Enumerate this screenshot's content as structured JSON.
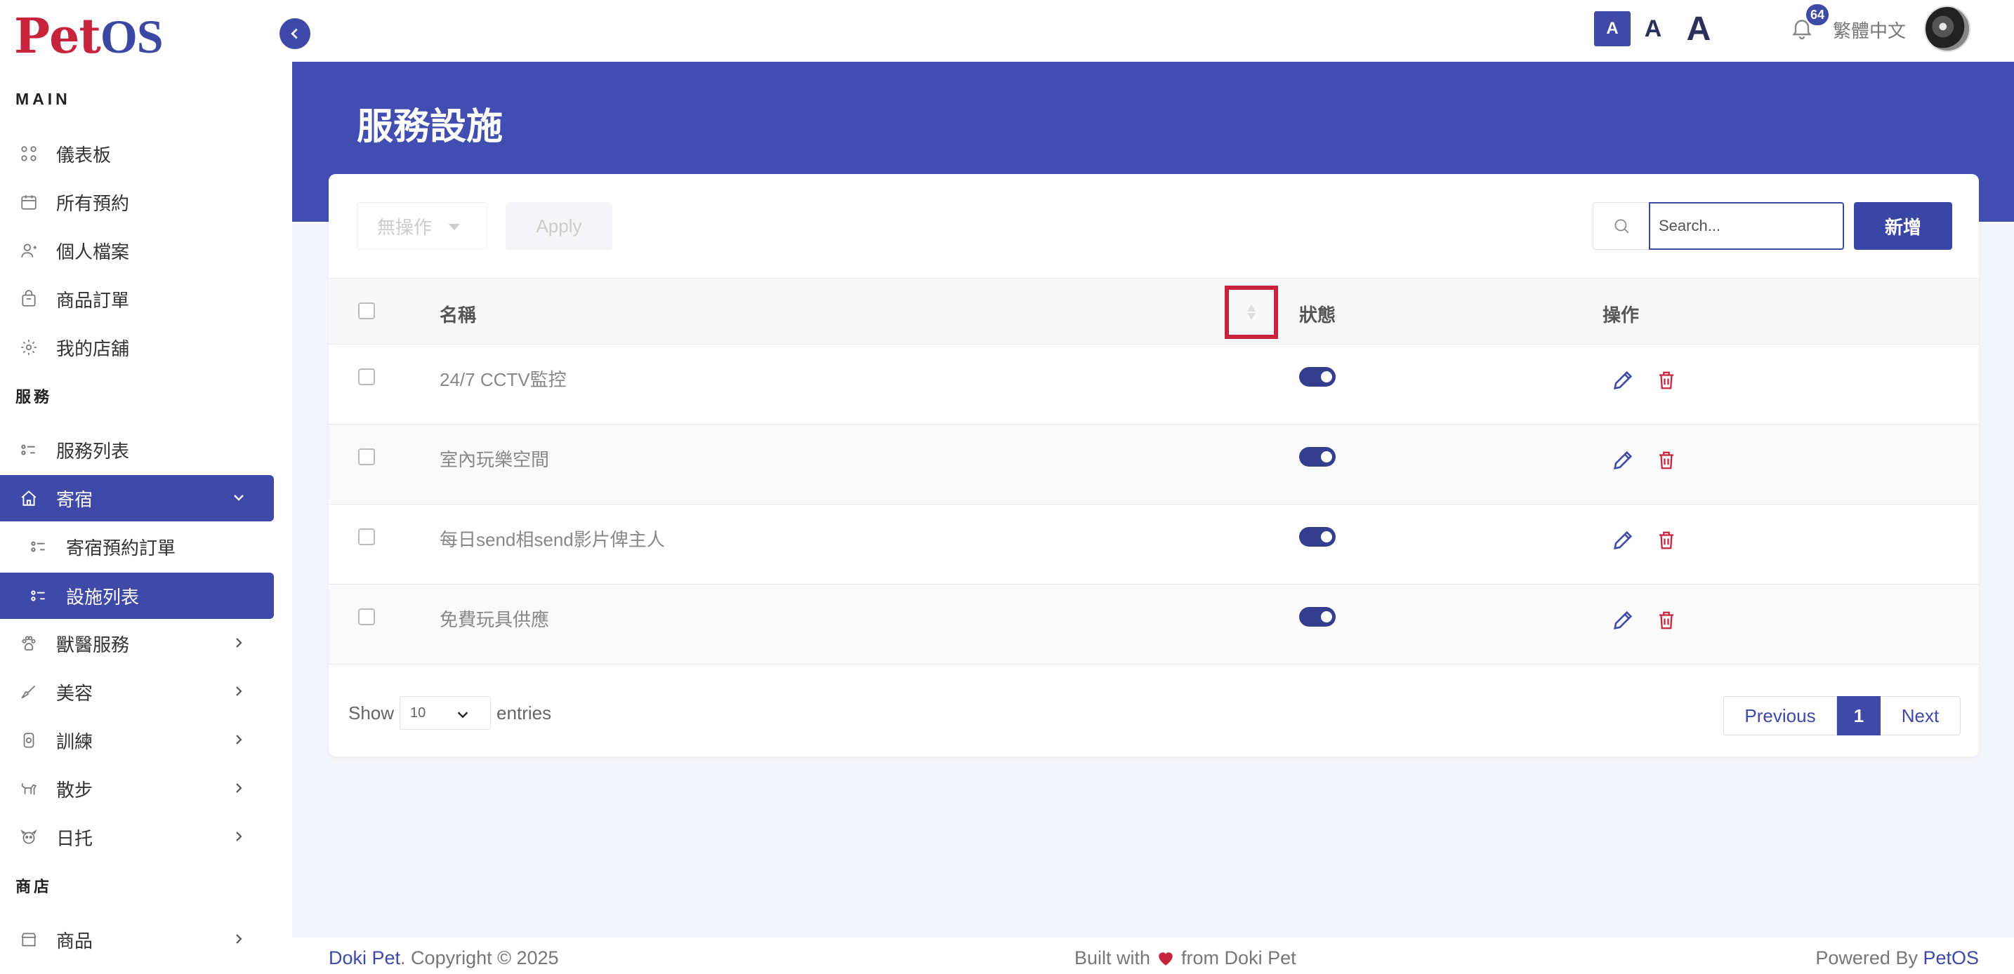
{
  "brand": {
    "logo_p": "P",
    "logo_rest": "et",
    "logo_os": "OS"
  },
  "sidebar": {
    "main_label": "MAIN",
    "service_label": "服務",
    "shop_label": "商店",
    "items": [
      {
        "label": "儀表板",
        "icon": "dashboard-icon"
      },
      {
        "label": "所有預約",
        "icon": "calendar-icon"
      },
      {
        "label": "個人檔案",
        "icon": "user-icon"
      },
      {
        "label": "商品訂單",
        "icon": "bag-icon"
      },
      {
        "label": "我的店舖",
        "icon": "store-icon"
      },
      {
        "label": "服務列表",
        "icon": "list-icon"
      },
      {
        "label": "寄宿",
        "icon": "home-icon"
      },
      {
        "label": "寄宿預約訂單",
        "icon": "list-icon"
      },
      {
        "label": "設施列表",
        "icon": "list-icon"
      },
      {
        "label": "獸醫服務",
        "icon": "paw-icon"
      },
      {
        "label": "美容",
        "icon": "brush-icon"
      },
      {
        "label": "訓練",
        "icon": "medal-icon"
      },
      {
        "label": "散步",
        "icon": "dog-icon"
      },
      {
        "label": "日托",
        "icon": "dog-face-icon"
      },
      {
        "label": "商品",
        "icon": "shop-icon"
      }
    ]
  },
  "topbar": {
    "font_small": "A",
    "font_medium": "A",
    "font_large": "A",
    "notification_count": "64",
    "language": "繁體中文"
  },
  "page": {
    "title": "服務設施"
  },
  "toolbar": {
    "bulk_action": "無操作",
    "apply_label": "Apply",
    "search_placeholder": "Search...",
    "add_label": "新增"
  },
  "table": {
    "headers": {
      "name": "名稱",
      "status": "狀態",
      "actions": "操作"
    },
    "rows": [
      {
        "name": "24/7 CCTV監控",
        "enabled": true
      },
      {
        "name": "室內玩樂空間",
        "enabled": true
      },
      {
        "name": "每日send相send影片俾主人",
        "enabled": true
      },
      {
        "name": "免費玩具供應",
        "enabled": true
      }
    ]
  },
  "pagination": {
    "show_label": "Show",
    "page_length": "10",
    "entries_label": "entries",
    "previous": "Previous",
    "current_page": "1",
    "next": "Next"
  },
  "footer": {
    "company": "Doki Pet",
    "copyright": ". Copyright © 2025",
    "built_with": "Built with",
    "from": "from Doki Pet",
    "powered_by": "Powered By ",
    "powered_brand": "PetOS"
  },
  "colors": {
    "primary": "#3f4aa8",
    "accent": "#c8233c",
    "band": "#414db1"
  }
}
